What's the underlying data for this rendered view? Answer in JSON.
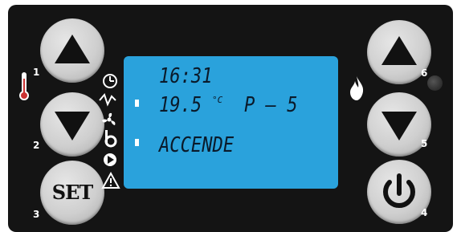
{
  "buttons": {
    "left": [
      {
        "number": "1",
        "symbol": "up-arrow"
      },
      {
        "number": "2",
        "symbol": "down-arrow"
      },
      {
        "number": "3",
        "label": "SET"
      }
    ],
    "right": [
      {
        "number": "6",
        "symbol": "up-arrow"
      },
      {
        "number": "5",
        "symbol": "down-arrow"
      },
      {
        "number": "4",
        "symbol": "power"
      }
    ]
  },
  "display": {
    "time": "16:31",
    "temperature": "19.5",
    "temperature_unit": "°C",
    "power_level": "P – 5",
    "status": "ACCENDE"
  },
  "icons": {
    "left_column": [
      "thermometer-icon",
      "clock-icon",
      "spark-icon",
      "fan-icon",
      "auger-icon",
      "pump-icon",
      "alarm-icon"
    ],
    "right_column": [
      "flame-icon"
    ]
  },
  "colors": {
    "panel": "#141414",
    "lcd": "#2aa2dc",
    "lcd_text": "#0a1a2a",
    "button": "#cfcfcf"
  }
}
